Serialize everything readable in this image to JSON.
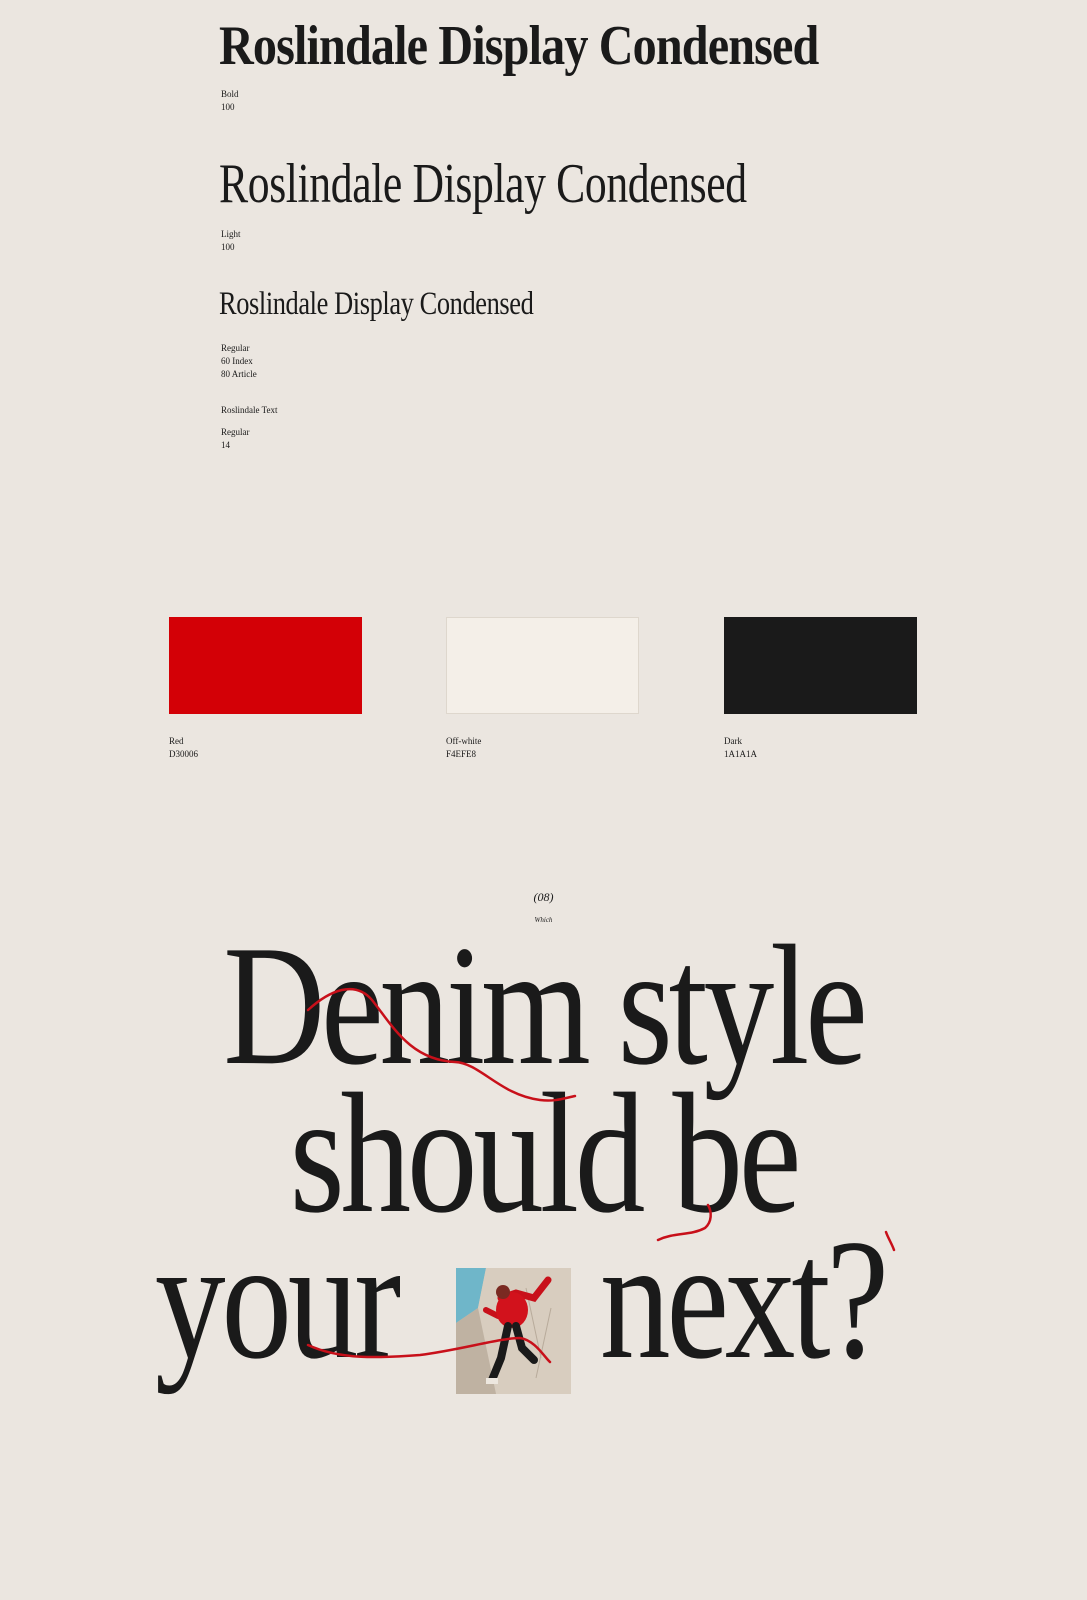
{
  "typography": {
    "bold": {
      "sample": "Roslindale Display Condensed",
      "weight": "Bold",
      "size": "100"
    },
    "light": {
      "sample": "Roslindale Display Condensed",
      "weight": "Light",
      "size": "100"
    },
    "regular": {
      "sample": "Roslindale Display Condensed",
      "weight": "Regular",
      "size_index": "60 Index",
      "size_article": "80 Article"
    },
    "text": {
      "family": "Roslindale Text",
      "weight": "Regular",
      "size": "14"
    }
  },
  "colors": [
    {
      "name": "Red",
      "hex": "D30006",
      "value": "#D30006"
    },
    {
      "name": "Off-white",
      "hex": "F4EFE8",
      "value": "#F4EFE8"
    },
    {
      "name": "Dark",
      "hex": "1A1A1A",
      "value": "#1A1A1A"
    }
  ],
  "section": {
    "number": "(08)",
    "name": "Which",
    "headline_lines": [
      "Denim style",
      "should be",
      "your",
      "next?"
    ]
  },
  "accent_color": "#D30006",
  "background_color": "#EBE6E0"
}
